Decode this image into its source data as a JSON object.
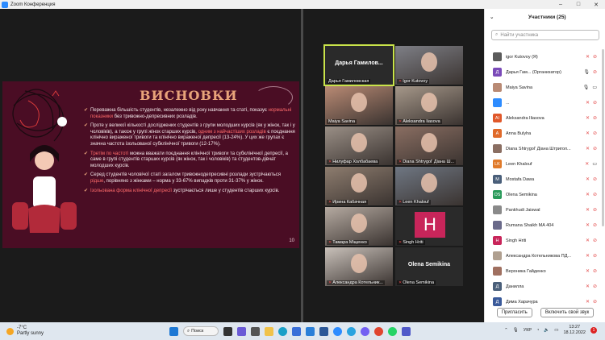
{
  "window": {
    "title": "Zoom Конференция",
    "minimize": "–",
    "maximize": "□",
    "close": "✕"
  },
  "slide": {
    "heading": "ВИСНОВКИ",
    "paragraphs": [
      {
        "before": "Переважна більшість студентів, незалежно від року навчання та статі, показує ",
        "highlight": "нормальні показники",
        "after": " без тривожно-депресивних розладів."
      },
      {
        "before": "Проте у великої кількості досліджених студентів з групи молодших курсів (як у жінок, так і у чоловіків), а також у групі жінок старших курсів, ",
        "highlight": "одним з найчастіших розладів",
        "after": " є поєднання клінічно вираженої тривоги та клінічно вираженої депресії (13-24%). У цих же групах є значна частота ізольованої субклінічної тривоги (12-17%)."
      },
      {
        "before": "",
        "highlight": "Третім по частоті",
        "after": " можна вважати поєднання клінічної тривоги та субклінічної депресії, а саме в групі студентів старших курсів (як жінок, так і чоловіків) та студентов-дівчат молодших курсів."
      },
      {
        "before": "Серед студентів чоловічої статі загалом тривожнодепресивні розлади зустрічаються ",
        "highlight": "рідше",
        "after": ", порівняно з жінками – норма у 33-67% випадків проти 31-37% у жінок."
      },
      {
        "before": "",
        "highlight": "Ізольована форма клінічної депресії",
        "after": " зустрічається лише у студентів старших курсів."
      }
    ],
    "page_number": "10"
  },
  "tiles": [
    {
      "name": "Дарья Гамиловская",
      "big": "Дарья Гамилов...",
      "muted": false,
      "active": true,
      "video": false
    },
    {
      "name": "Igor Kutovoy",
      "muted": true,
      "video": true,
      "tone": "#7e7f86"
    },
    {
      "name": "Maiya Savina",
      "muted": false,
      "video": true,
      "tone": "#b98a74"
    },
    {
      "name": "Aleksandra Iiasova",
      "muted": true,
      "video": true,
      "tone": "#a6988a"
    },
    {
      "name": "Нилуфар Холбабаева",
      "muted": true,
      "video": true,
      "tone": "#9a8f86"
    },
    {
      "name": "Diana Shtrygol' Діана Ш...",
      "muted": true,
      "video": true,
      "tone": "#8a6e62"
    },
    {
      "name": "Ирина Кабачная",
      "muted": true,
      "video": true,
      "tone": "#8e7d6f"
    },
    {
      "name": "Leen Khalouf",
      "muted": true,
      "video": true,
      "tone": "#6f7783"
    },
    {
      "name": "Тамара Міщенко",
      "muted": true,
      "video": true,
      "tone": "#b5aaa1"
    },
    {
      "name": "Singh Hriti",
      "muted": true,
      "video": false,
      "letter": "H"
    },
    {
      "name": "Александра Котельник...",
      "muted": true,
      "video": true,
      "tone": "#c9c1ba"
    },
    {
      "name": "Olena Semikina",
      "big": "Olena Semikina",
      "muted": true,
      "video": false
    }
  ],
  "participants_panel": {
    "title": "Участники (25)",
    "search_placeholder": "Найти участника",
    "invite_label": "Пригласить",
    "unmute_label": "Включить свой звук",
    "people": [
      {
        "name": "igor Kutovoy (Я)",
        "initials": "",
        "color": "#5b5b5b",
        "muted": true,
        "video_off": true
      },
      {
        "name": "Дарья Гам... (Организатор)",
        "initials": "Д",
        "color": "#7a4ab8",
        "muted": false,
        "video_off": true
      },
      {
        "name": "Maiya Savina",
        "initials": "",
        "color": "#b98a74",
        "muted": false,
        "video_off": false
      },
      {
        "name": "...",
        "initials": "",
        "color": "#2d8cff",
        "muted": true,
        "video_off": true
      },
      {
        "name": "Aleksandra Iliasova",
        "initials": "AI",
        "color": "#e0582a",
        "muted": true,
        "video_off": true
      },
      {
        "name": "Anna Bulyha",
        "initials": "A",
        "color": "#e06a2a",
        "muted": true,
        "video_off": true
      },
      {
        "name": "Diana Shtrygol' Діана Штригол...",
        "initials": "",
        "color": "#8a6e62",
        "muted": true,
        "video_off": true
      },
      {
        "name": "Leen Khalouf",
        "initials": "LK",
        "color": "#e07a2a",
        "muted": true,
        "video_off": false
      },
      {
        "name": "Mostafa Dawa",
        "initials": "M",
        "color": "#4a5f7a",
        "muted": true,
        "video_off": true
      },
      {
        "name": "Olena Semikina",
        "initials": "OS",
        "color": "#2a9a5a",
        "muted": true,
        "video_off": true
      },
      {
        "name": "Pankhudi Jaiswal",
        "initials": "",
        "color": "#8a8a8a",
        "muted": true,
        "video_off": true
      },
      {
        "name": "Rumana Shaikh MA 404",
        "initials": "",
        "color": "#6a6a8a",
        "muted": true,
        "video_off": true
      },
      {
        "name": "Singh Hriti",
        "initials": "H",
        "color": "#c8255a",
        "muted": true,
        "video_off": true
      },
      {
        "name": "Александра Котельникова ПД...",
        "initials": "",
        "color": "#b0a090",
        "muted": true,
        "video_off": true
      },
      {
        "name": "Вероника Гайденко",
        "initials": "",
        "color": "#a07060",
        "muted": true,
        "video_off": true
      },
      {
        "name": "Данилла",
        "initials": "Д",
        "color": "#4a5f7a",
        "muted": true,
        "video_off": true
      },
      {
        "name": "Дима Харачура",
        "initials": "Д",
        "color": "#3a5a9a",
        "muted": true,
        "video_off": true
      }
    ]
  },
  "taskbar": {
    "temperature": "-7°C",
    "weather": "Partly sunny",
    "search_label": "Поиск",
    "language": "УКР",
    "time": "13:27",
    "date": "18.12.2022",
    "notifications": "1"
  }
}
